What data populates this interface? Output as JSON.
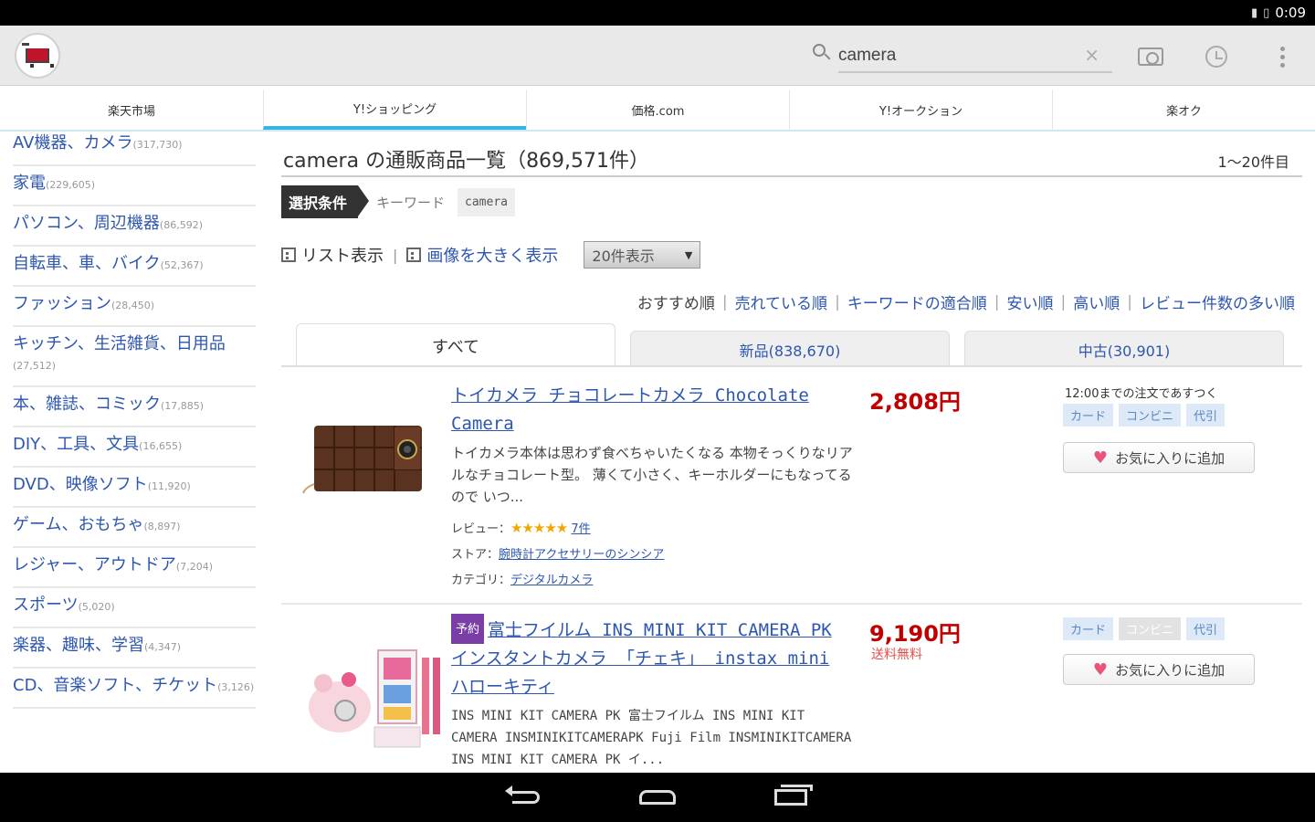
{
  "status_bar": {
    "time": "0:09",
    "signal": "signal",
    "battery": "battery"
  },
  "app": {
    "logo_icon": "shopping-cart-icon"
  },
  "search": {
    "value": "camera",
    "clear_label": "×"
  },
  "tabs": [
    {
      "label": "楽天市場",
      "active": false
    },
    {
      "label": "Y!ショッピング",
      "active": true
    },
    {
      "label": "価格.com",
      "active": false
    },
    {
      "label": "Y!オークション",
      "active": false
    },
    {
      "label": "楽オク",
      "active": false
    }
  ],
  "categories": [
    {
      "name": "AV機器、カメラ",
      "count": "(317,730)"
    },
    {
      "name": "家電",
      "count": "(229,605)"
    },
    {
      "name": "パソコン、周辺機器",
      "count": "(86,592)"
    },
    {
      "name": "自転車、車、バイク",
      "count": "(52,367)"
    },
    {
      "name": "ファッション",
      "count": "(28,450)"
    },
    {
      "name": "キッチン、生活雑貨、日用品",
      "count": "(27,512)"
    },
    {
      "name": "本、雑誌、コミック",
      "count": "(17,885)"
    },
    {
      "name": "DIY、工具、文具",
      "count": "(16,655)"
    },
    {
      "name": "DVD、映像ソフト",
      "count": "(11,920)"
    },
    {
      "name": "ゲーム、おもちゃ",
      "count": "(8,897)"
    },
    {
      "name": "レジャー、アウトドア",
      "count": "(7,204)"
    },
    {
      "name": "スポーツ",
      "count": "(5,020)"
    },
    {
      "name": "楽器、趣味、学習",
      "count": "(4,347)"
    },
    {
      "name": "CD、音楽ソフト、チケット",
      "count": "(3,126)"
    }
  ],
  "results": {
    "heading": "camera の通販商品一覧（869,571件）",
    "range": "1〜20件目"
  },
  "condition": {
    "tag": "選択条件",
    "keyword_label": "キーワード",
    "keyword_value": "camera"
  },
  "view": {
    "list": "リスト表示",
    "separator": "|",
    "large": "画像を大きく表示",
    "count_select": "20件表示",
    "count_arrow": "▼"
  },
  "sort": {
    "active": "おすすめ順",
    "sep": "|",
    "options": [
      "売れている順",
      "キーワードの適合順",
      "安い順",
      "高い順",
      "レビュー件数の多い順"
    ]
  },
  "condition_tabs": [
    {
      "label": "すべて",
      "active": true
    },
    {
      "label": "新品(838,670)",
      "active": false
    },
    {
      "label": "中古(30,901)",
      "active": false
    }
  ],
  "products": [
    {
      "title": "トイカメラ チョコレートカメラ Chocolate Camera",
      "price": "2,808円",
      "description": "トイカメラ本体は思わず食べちゃいたくなる 本物そっくりなリアルなチョコレート型。 薄くて小さく、キーホルダーにもなってるので いつ...",
      "review_label": "レビュー：",
      "stars": "★★★★★",
      "review_count": "7件",
      "store_label": "ストア：",
      "store": "腕時計アクセサリーのシンシア",
      "category_label": "カテゴリ：",
      "category": "デジタルカメラ",
      "delivery_note": "12:00までの注文であすつく",
      "payments": [
        {
          "label": "カード",
          "enabled": true
        },
        {
          "label": "コンビニ",
          "enabled": true
        },
        {
          "label": "代引",
          "enabled": true
        }
      ],
      "favorite_label": "お気に入りに追加"
    },
    {
      "badge": "予約",
      "title": "富士フイルム INS MINI KIT CAMERA PK インスタントカメラ 「チェキ」 instax mini ハローキティ",
      "price": "9,190円",
      "shipping": "送料無料",
      "description": "INS MINI KIT CAMERA PK 富士フイルム INS MINI KIT CAMERA INSMINIKITCAMERAPK Fuji Film INSMINIKITCAMERA INS MINI KIT CAMERA PK イ...",
      "payments": [
        {
          "label": "カード",
          "enabled": true
        },
        {
          "label": "コンビニ",
          "enabled": false
        },
        {
          "label": "代引",
          "enabled": true
        }
      ],
      "favorite_label": "お気に入りに追加"
    }
  ],
  "colors": {
    "link": "#2c56b0",
    "price": "#c00000",
    "tab_accent": "#33b5e5",
    "star": "#f0a800",
    "heart": "#e8557a"
  }
}
